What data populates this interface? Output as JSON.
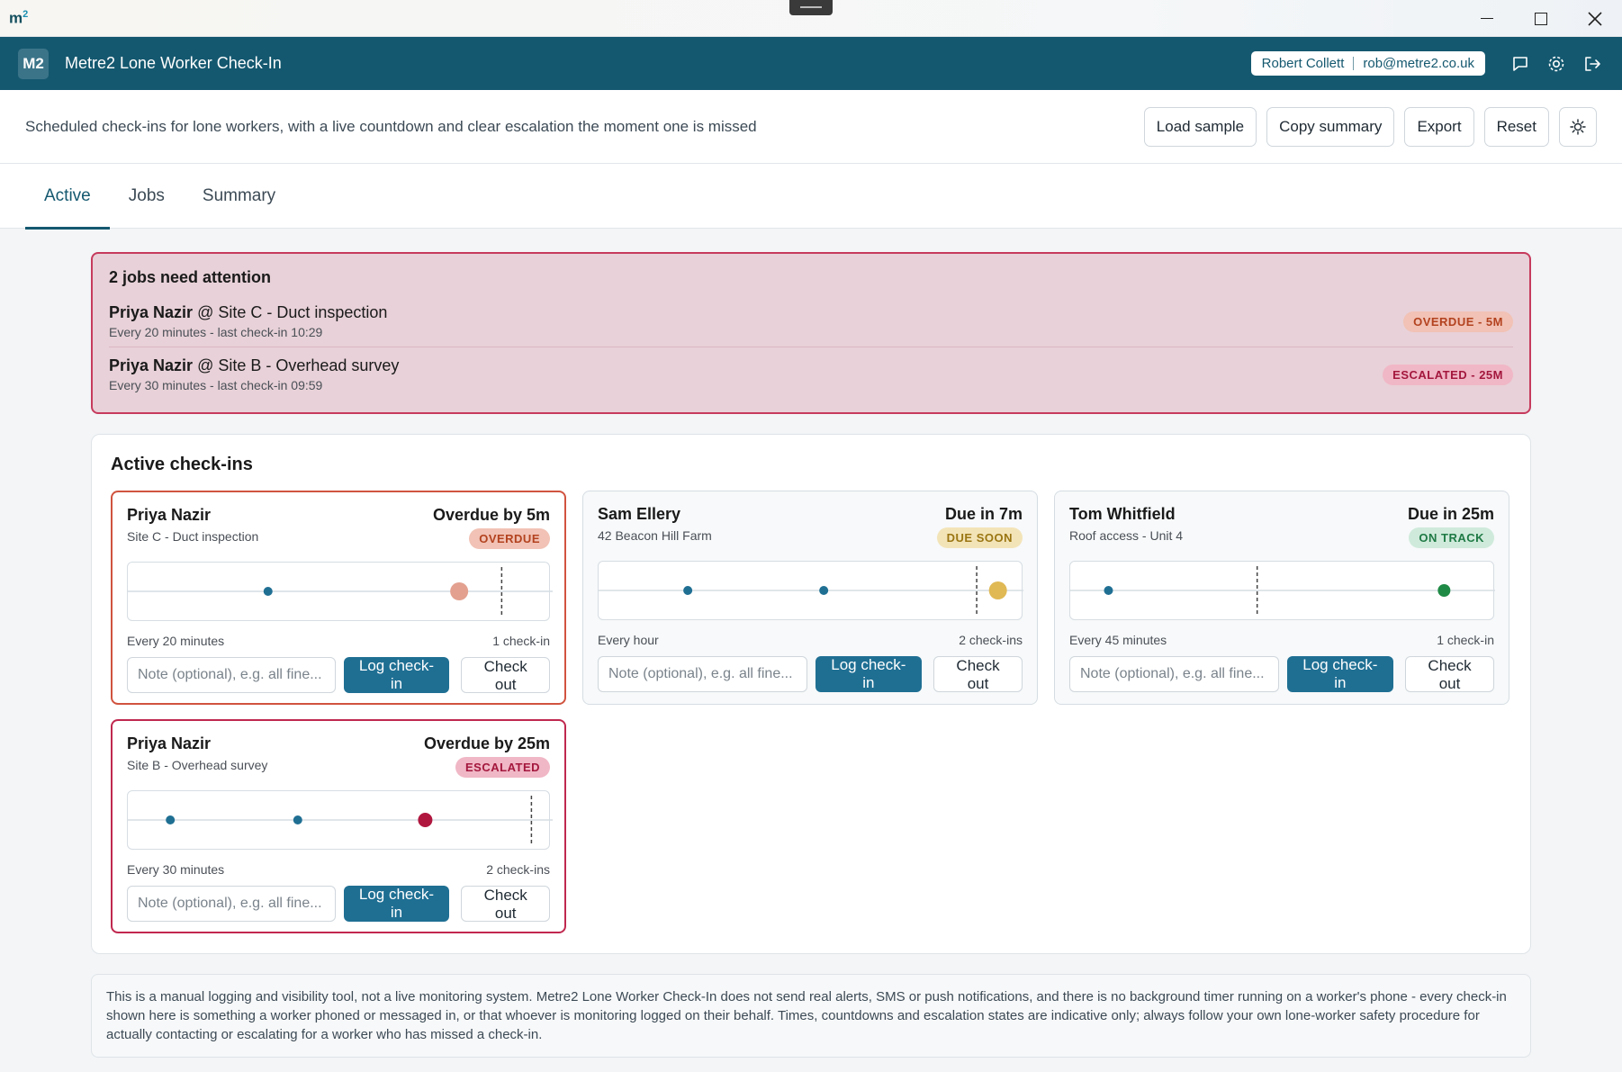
{
  "window": {
    "logo": "m",
    "logo_sup": "2"
  },
  "appbar": {
    "badge": "M2",
    "title": "Metre2 Lone Worker Check-In",
    "user_name": "Robert Collett",
    "user_email": "rob@metre2.co.uk"
  },
  "toolbar": {
    "description": "Scheduled check-ins for lone workers, with a live countdown and clear escalation the moment one is missed",
    "load_sample": "Load sample",
    "copy_summary": "Copy summary",
    "export": "Export",
    "reset": "Reset"
  },
  "tabs": [
    {
      "label": "Active",
      "active": true
    },
    {
      "label": "Jobs",
      "active": false
    },
    {
      "label": "Summary",
      "active": false
    }
  ],
  "attention": {
    "title": "2 jobs need attention",
    "items": [
      {
        "worker": "Priya Nazir",
        "at": "@ Site C - Duct inspection",
        "detail": "Every 20 minutes - last check-in 10:29",
        "badge": "OVERDUE - 5M",
        "kind": "overdue"
      },
      {
        "worker": "Priya Nazir",
        "at": "@ Site B - Overhead survey",
        "detail": "Every 30 minutes - last check-in 09:59",
        "badge": "ESCALATED - 25M",
        "kind": "escalated"
      }
    ]
  },
  "active": {
    "title": "Active check-ins",
    "note_placeholder": "Note (optional), e.g. all fine...",
    "log_label": "Log check-in",
    "checkout_label": "Check out",
    "cards": [
      {
        "name": "Priya Nazir",
        "site": "Site C - Duct inspection",
        "status": "Overdue by 5m",
        "badge": "OVERDUE",
        "kind": "overdue",
        "interval": "Every 20 minutes",
        "count": "1 check-in",
        "checkins": [
          0.33
        ],
        "due": 0.88,
        "now": 0.78,
        "now_color": "#e3a08f",
        "now_r": 10
      },
      {
        "name": "Sam Ellery",
        "site": "42 Beacon Hill Farm",
        "status": "Due in 7m",
        "badge": "DUE SOON",
        "kind": "duesoon",
        "interval": "Every hour",
        "count": "2 check-ins",
        "checkins": [
          0.21,
          0.53
        ],
        "due": 0.89,
        "now": 0.94,
        "now_color": "#e0b955",
        "now_r": 10
      },
      {
        "name": "Tom Whitfield",
        "site": "Roof access - Unit 4",
        "status": "Due in 25m",
        "badge": "ON TRACK",
        "kind": "ontrack",
        "interval": "Every 45 minutes",
        "count": "1 check-in",
        "checkins": [
          0.09
        ],
        "due": 0.44,
        "now": 0.88,
        "now_color": "#1f8a45",
        "now_r": 7
      },
      {
        "name": "Priya Nazir",
        "site": "Site B - Overhead survey",
        "status": "Overdue by 25m",
        "badge": "ESCALATED",
        "kind": "escalated",
        "interval": "Every 30 minutes",
        "count": "2 check-ins",
        "checkins": [
          0.1,
          0.4
        ],
        "due": 0.95,
        "now": 0.7,
        "now_color": "#b0173f",
        "now_r": 8
      }
    ]
  },
  "disclaimer": "This is a manual logging and visibility tool, not a live monitoring system. Metre2 Lone Worker Check-In does not send real alerts, SMS or push notifications, and there is no background timer running on a worker's phone - every check-in shown here is something a worker phoned or messaged in, or that whoever is monitoring logged on their behalf. Times, countdowns and escalation states are indicative only; always follow your own lone-worker safety procedure for actually contacting or escalating for a worker who has missed a check-in."
}
